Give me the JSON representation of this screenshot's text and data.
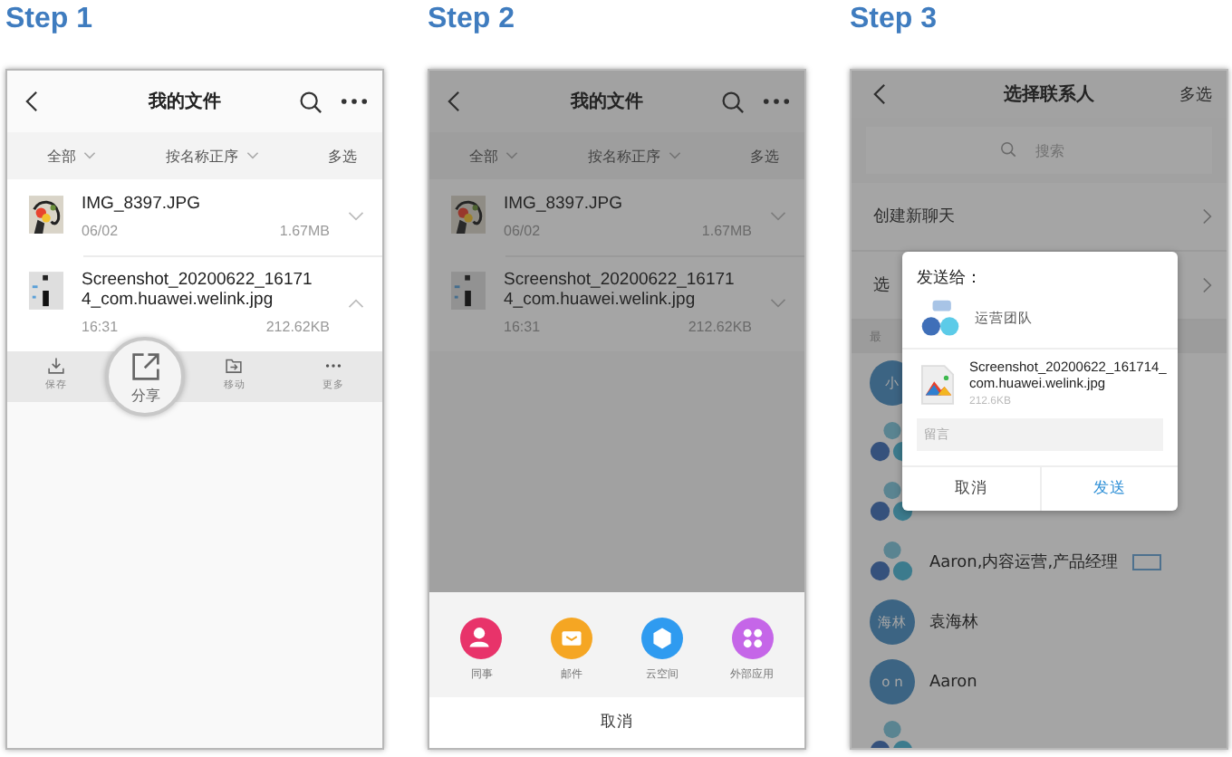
{
  "panels": [
    {
      "kind": "files",
      "step": "Step 1",
      "title": "我的文件",
      "dimmed": false,
      "filters": [
        {
          "label": "全部",
          "dropdown": true
        },
        {
          "label": "按名称正序",
          "dropdown": true
        },
        {
          "label": "多选",
          "dropdown": false
        }
      ],
      "files": [
        {
          "name": "IMG_8397.JPG",
          "date": "06/02",
          "size": "1.67MB",
          "expanded": false
        },
        {
          "name": "Screenshot_20200622_161714_com.huawei.welink.jpg",
          "date": "16:31",
          "size": "212.62KB",
          "kind": "screenshot",
          "expanded": true
        }
      ],
      "actions": [
        {
          "kind": "save",
          "label": "保存",
          "selected": false
        },
        {
          "kind": "share",
          "label": "分享",
          "selected": true
        },
        {
          "kind": "move",
          "label": "移动",
          "selected": false
        },
        {
          "kind": "more",
          "label": "更多",
          "selected": false
        }
      ]
    },
    {
      "kind": "files",
      "step": "Step 2",
      "title": "我的文件",
      "dimmed": true,
      "filters": [
        {
          "label": "全部",
          "dropdown": true
        },
        {
          "label": "按名称正序",
          "dropdown": true
        },
        {
          "label": "多选",
          "dropdown": false
        }
      ],
      "files": [
        {
          "name": "IMG_8397.JPG",
          "date": "06/02",
          "size": "1.67MB",
          "expanded": false
        },
        {
          "name": "Screenshot_20200622_161714_com.huawei.welink.jpg",
          "date": "16:31",
          "size": "212.62KB",
          "kind": "screenshot",
          "expanded": false
        }
      ],
      "share_sheet": {
        "targets": [
          {
            "kind": "colleague",
            "label": "同事",
            "color": "#e8336a"
          },
          {
            "kind": "mail",
            "label": "邮件",
            "color": "#f5a623"
          },
          {
            "kind": "cloud",
            "label": "云空间",
            "color": "#2f9bf0"
          },
          {
            "kind": "apps",
            "label": "外部应用",
            "color": "#c566e8"
          }
        ],
        "cancel": "取消"
      }
    },
    {
      "kind": "contacts",
      "step": "Step 3",
      "title": "选择联系人",
      "action": "多选",
      "search_placeholder": "搜索",
      "menu": [
        {
          "label": "创建新聊天"
        },
        {
          "label": "选"
        }
      ],
      "section": "最",
      "contacts": [
        {
          "kind": "person",
          "avatar": "小"
        },
        {
          "kind": "group"
        },
        {
          "kind": "group"
        },
        {
          "kind": "group",
          "name": "Aaron,内容运营,产品经理",
          "tag": true
        },
        {
          "kind": "person",
          "avatar": "海林",
          "name": "袁海林"
        },
        {
          "kind": "person",
          "avatar": "o n",
          "name": "Aaron"
        },
        {
          "kind": "group"
        }
      ],
      "dialog": {
        "title": "发送给：",
        "recipient": "运营团队",
        "file_name": "Screenshot_20200622_161714_com.huawei.welink.jpg",
        "file_size": "212.6KB",
        "message_placeholder": "留言",
        "cancel": "取消",
        "send": "发送"
      }
    }
  ]
}
